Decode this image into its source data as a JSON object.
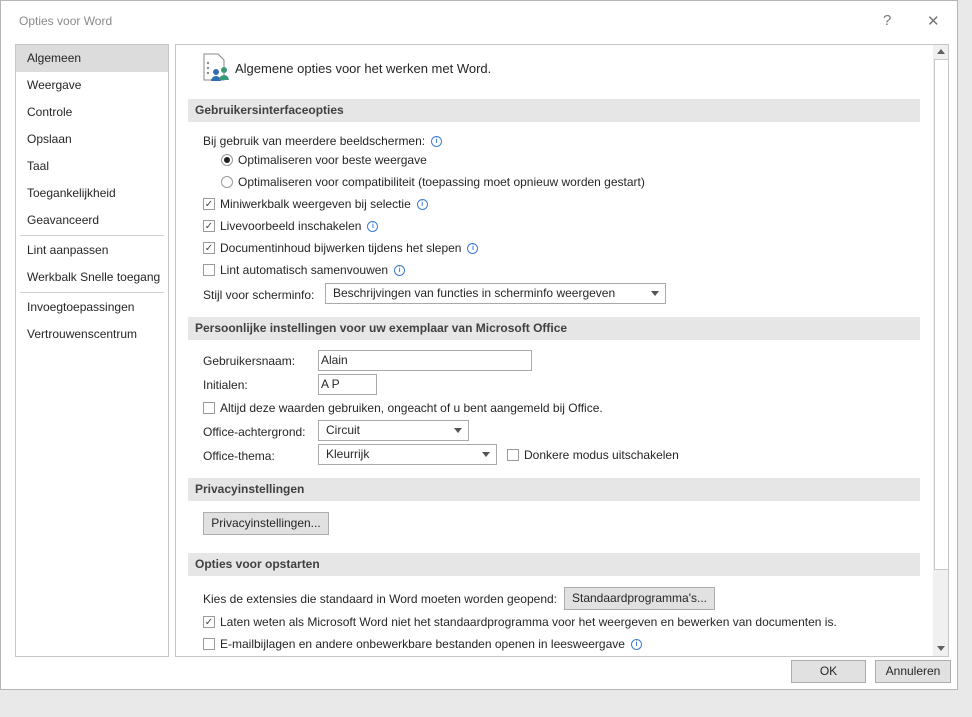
{
  "window": {
    "title": "Opties voor Word",
    "help": "?",
    "close": "✕"
  },
  "sidebar": {
    "items": [
      {
        "label": "Algemeen"
      },
      {
        "label": "Weergave"
      },
      {
        "label": "Controle"
      },
      {
        "label": "Opslaan"
      },
      {
        "label": "Taal"
      },
      {
        "label": "Toegankelijkheid"
      },
      {
        "label": "Geavanceerd"
      },
      {
        "label": "Lint aanpassen"
      },
      {
        "label": "Werkbalk Snelle toegang"
      },
      {
        "label": "Invoegtoepassingen"
      },
      {
        "label": "Vertrouwenscentrum"
      }
    ]
  },
  "main": {
    "heading": "Algemene opties voor het werken met Word.",
    "ui": {
      "title": "Gebruikersinterfaceopties",
      "multi_label": "Bij gebruik van meerdere beeldschermen:",
      "radio1": "Optimaliseren voor beste weergave",
      "radio2": "Optimaliseren voor compatibiliteit (toepassing moet opnieuw worden gestart)",
      "cb1": "Miniwerkbalk weergeven bij selectie",
      "cb2": "Livevoorbeeld inschakelen",
      "cb3": "Documentinhoud bijwerken tijdens het slepen",
      "cb4": "Lint automatisch samenvouwen",
      "tooltip_label": "Stijl voor scherminfo:",
      "tooltip_value": "Beschrijvingen van functies in scherminfo weergeven"
    },
    "personal": {
      "title": "Persoonlijke instellingen voor uw exemplaar van Microsoft Office",
      "username_label": "Gebruikersnaam:",
      "username": "Alain",
      "initials_label": "Initialen:",
      "initials": "A P",
      "always_label": "Altijd deze waarden gebruiken, ongeacht of u bent aangemeld bij Office.",
      "bg_label": "Office-achtergrond:",
      "bg_value": "Circuit",
      "theme_label": "Office-thema:",
      "theme_value": "Kleurrijk",
      "dark_label": "Donkere modus uitschakelen"
    },
    "privacy": {
      "title": "Privacyinstellingen",
      "button": "Privacyinstellingen..."
    },
    "startup": {
      "title": "Opties voor opstarten",
      "ext_label": "Kies de extensies die standaard in Word moeten worden geopend:",
      "ext_button": "Standaardprogramma's...",
      "cb1": "Laten weten als Microsoft Word niet het standaardprogramma voor het weergeven en bewerken van documenten is.",
      "cb2": "E-mailbijlagen en andere onbewerkbare bestanden openen in leesweergave"
    }
  },
  "footer": {
    "ok": "OK",
    "cancel": "Annuleren"
  }
}
